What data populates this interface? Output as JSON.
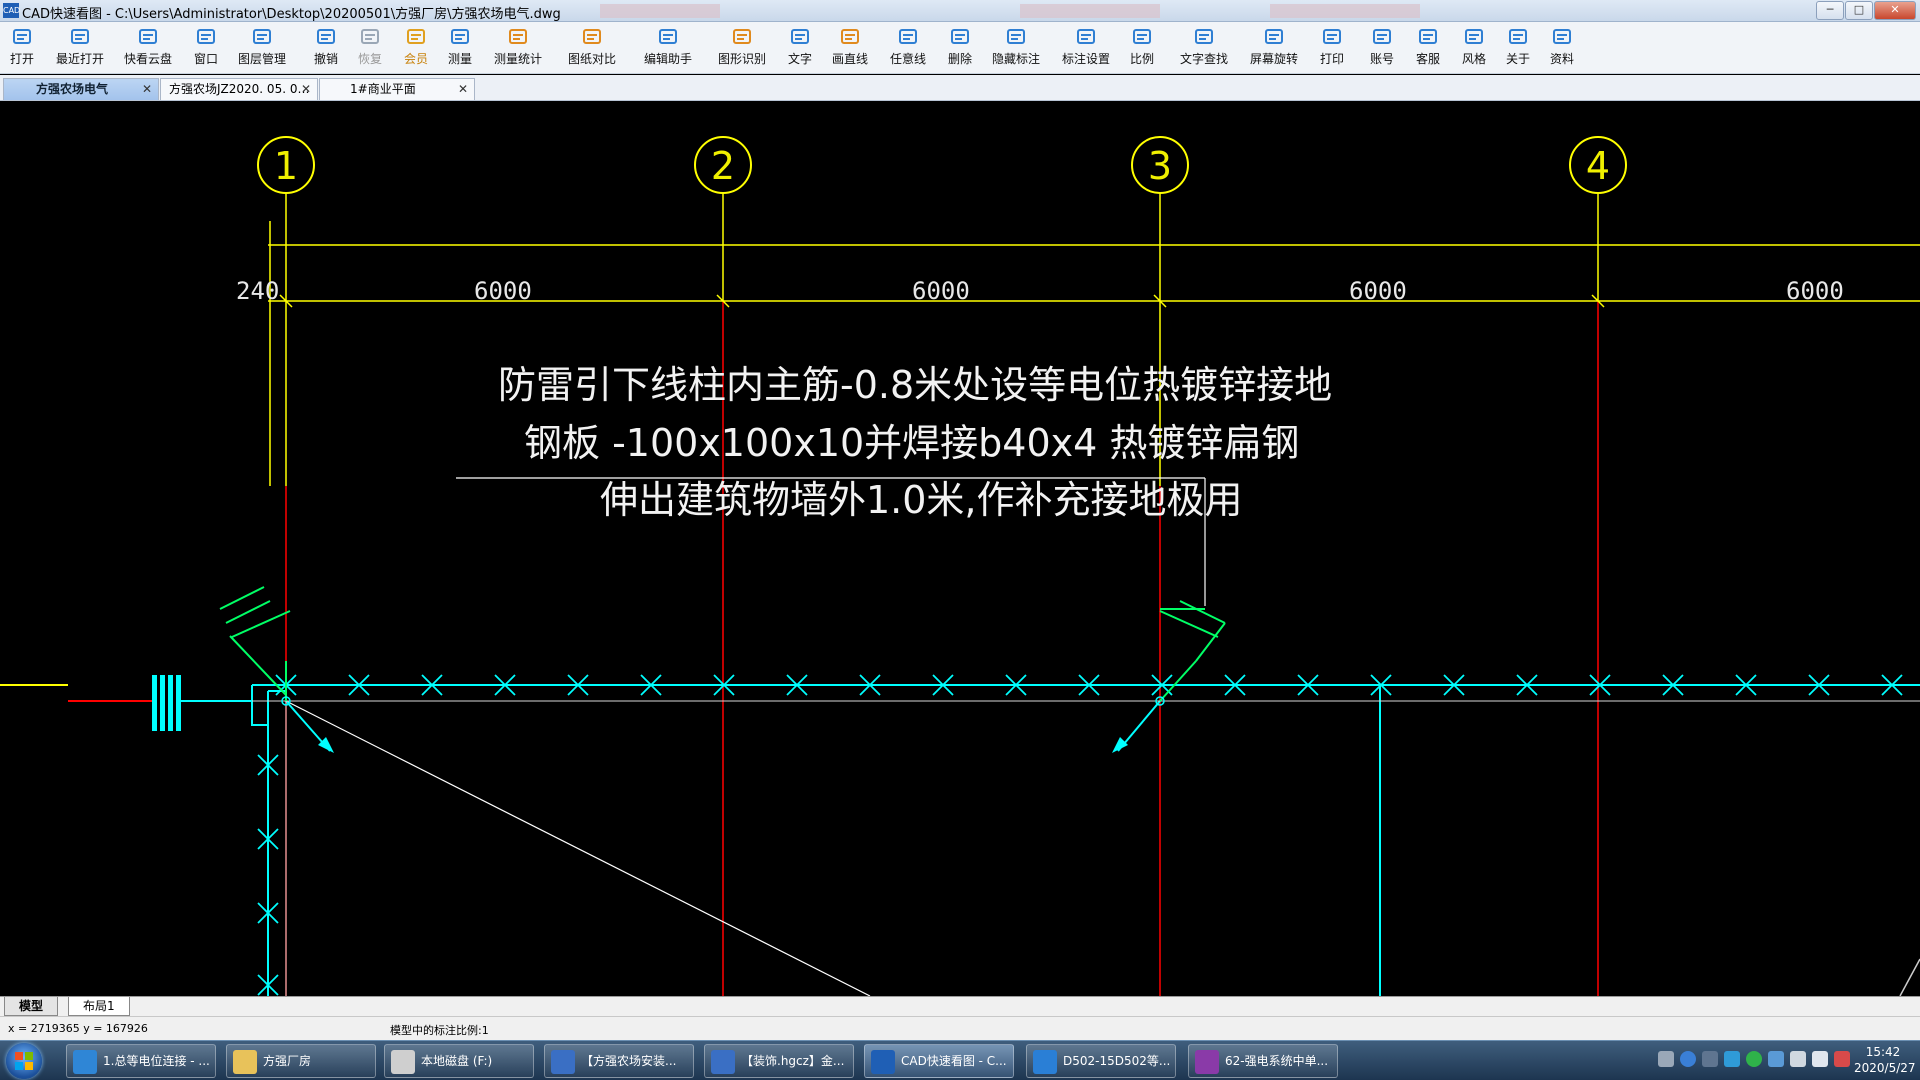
{
  "window": {
    "app_icon_text": "CAD",
    "title": "CAD快速看图 - C:\\Users\\Administrator\\Desktop\\20200501\\方强厂房\\方强农场电气.dwg",
    "min_glyph": "─",
    "max_glyph": "□",
    "close_glyph": "✕"
  },
  "toolbar": {
    "items": [
      {
        "label": "打开",
        "icon": "folder-open-icon",
        "color": "#2f7fd3"
      },
      {
        "label": "最近打开",
        "icon": "history-icon",
        "color": "#2f7fd3"
      },
      {
        "label": "快看云盘",
        "icon": "cloud-icon",
        "color": "#2f7fd3"
      },
      {
        "label": "窗口",
        "icon": "window-select-icon",
        "color": "#2f7fd3"
      },
      {
        "label": "图层管理",
        "icon": "layers-icon",
        "color": "#2f7fd3"
      },
      {
        "label": "撤销",
        "icon": "undo-icon",
        "color": "#2f7fd3"
      },
      {
        "label": "恢复",
        "icon": "redo-icon",
        "color": "#9aa7b6"
      },
      {
        "label": "会员",
        "icon": "vip-icon",
        "color": "#e0a020"
      },
      {
        "label": "测量",
        "icon": "measure-icon",
        "color": "#2f7fd3"
      },
      {
        "label": "测量统计",
        "icon": "measure-stats-icon",
        "color": "#e08a1e"
      },
      {
        "label": "图纸对比",
        "icon": "compare-icon",
        "color": "#e08a1e"
      },
      {
        "label": "编辑助手",
        "icon": "edit-assistant-icon",
        "color": "#2f7fd3"
      },
      {
        "label": "图形识别",
        "icon": "shape-recognize-icon",
        "color": "#e08a1e"
      },
      {
        "label": "文字",
        "icon": "text-icon",
        "color": "#2f7fd3"
      },
      {
        "label": "画直线",
        "icon": "line-icon",
        "color": "#e08a1e"
      },
      {
        "label": "任意线",
        "icon": "pen-icon",
        "color": "#2f7fd3"
      },
      {
        "label": "删除",
        "icon": "eraser-icon",
        "color": "#2f7fd3"
      },
      {
        "label": "隐藏标注",
        "icon": "eye-hide-icon",
        "color": "#2f7fd3"
      },
      {
        "label": "标注设置",
        "icon": "annotation-settings-icon",
        "color": "#2f7fd3"
      },
      {
        "label": "比例",
        "icon": "scale-icon",
        "color": "#2f7fd3"
      },
      {
        "label": "文字查找",
        "icon": "text-search-icon",
        "color": "#2f7fd3"
      },
      {
        "label": "屏幕旋转",
        "icon": "rotate-icon",
        "color": "#2f7fd3"
      },
      {
        "label": "打印",
        "icon": "print-icon",
        "color": "#2f7fd3"
      },
      {
        "label": "账号",
        "icon": "user-icon",
        "color": "#2f7fd3"
      },
      {
        "label": "客服",
        "icon": "headset-icon",
        "color": "#2f7fd3"
      },
      {
        "label": "风格",
        "icon": "style-icon",
        "color": "#2f7fd3"
      },
      {
        "label": "关于",
        "icon": "info-icon",
        "color": "#2f7fd3"
      },
      {
        "label": "资料",
        "icon": "resources-icon",
        "color": "#2f7fd3"
      }
    ]
  },
  "tabs": [
    {
      "label": "方强农场电气",
      "close": "✕"
    },
    {
      "label": "方强农场JZ2020. 05. 0…",
      "close": "✕"
    },
    {
      "label": "1#商业平面",
      "close": "✕"
    }
  ],
  "drawing": {
    "axis_labels": [
      "1",
      "2",
      "3",
      "4"
    ],
    "dimension_labels": [
      "240",
      "6000",
      "6000",
      "6000",
      "6000"
    ],
    "note_lines": [
      "防雷引下线柱内主筋-0.8米处设等电位热镀锌接地",
      "钢板 -100x100x10并焊接b40x4 热镀锌扁钢",
      "伸出建筑物墙外1.0米,作补充接地极用"
    ],
    "colors": {
      "axis_bubble": "#ffff00",
      "dimension": "#ffff00",
      "column_line": "#ff0000",
      "ground_wire": "#00ffff",
      "text": "#ffffff",
      "leader": "#ffffff"
    }
  },
  "layout_tabs": [
    "模型",
    "布局1"
  ],
  "status": {
    "coords": "x = 2719365  y = 167926",
    "scale_text": "模型中的标注比例:1"
  },
  "taskbar": {
    "items": [
      {
        "label": "1.总等电位连接 - ...",
        "icon": "browser-icon",
        "color": "#2f86d6"
      },
      {
        "label": "方强厂房",
        "icon": "folder-icon",
        "color": "#e8c25a"
      },
      {
        "label": "本地磁盘 (F:)",
        "icon": "drive-icon",
        "color": "#cfcfcf"
      },
      {
        "label": "【方强农场安装...",
        "icon": "doc-icon",
        "color": "#3a6fc4"
      },
      {
        "label": "【装饰.hgcz】金...",
        "icon": "doc-icon",
        "color": "#3a6fc4"
      },
      {
        "label": "CAD快速看图 - C...",
        "icon": "cad-icon",
        "color": "#1f5fb5"
      },
      {
        "label": "D502-15D502等...",
        "icon": "pdf-reader-icon",
        "color": "#2a7fd6"
      },
      {
        "label": "62-强电系统中单...",
        "icon": "archive-icon",
        "color": "#8a3aa8"
      }
    ],
    "clock_time": "15:42",
    "clock_date": "2020/5/27"
  }
}
